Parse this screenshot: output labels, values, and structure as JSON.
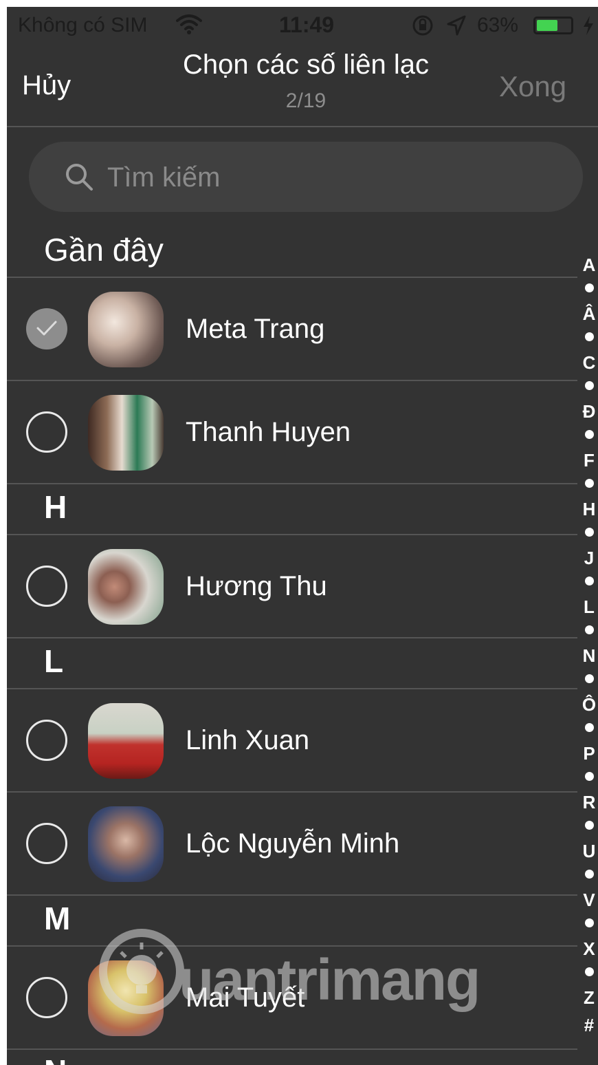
{
  "status_bar": {
    "carrier": "Không có SIM",
    "time": "11:49",
    "battery_percent": "63%",
    "battery_level": 0.63,
    "battery_color": "#43d351"
  },
  "nav": {
    "cancel_label": "Hủy",
    "title": "Chọn các số liên lạc",
    "subtitle": "2/19",
    "done_label": "Xong"
  },
  "search": {
    "placeholder": "Tìm kiếm",
    "icon": "search-icon"
  },
  "recent_header": "Gần đây",
  "contacts": [
    {
      "name": "Meta Trang",
      "selected": true
    },
    {
      "name": "Thanh Huyen",
      "selected": false
    },
    {
      "name": "Hương Thu",
      "selected": false
    },
    {
      "name": "Linh Xuan",
      "selected": false
    },
    {
      "name": "Lộc Nguyễn Minh",
      "selected": false
    },
    {
      "name": "Mai Tuyết",
      "selected": false
    }
  ],
  "section_letters": [
    "H",
    "L",
    "M",
    "N"
  ],
  "index_letters": [
    "A",
    "Â",
    "C",
    "Đ",
    "F",
    "H",
    "J",
    "L",
    "N",
    "Ô",
    "P",
    "R",
    "U",
    "V",
    "X",
    "Z",
    "#"
  ],
  "watermark": "uantrimang",
  "colors": {
    "background": "#333333",
    "accent_check": "#8d8d8d",
    "disabled_text": "#7a7a7a"
  }
}
